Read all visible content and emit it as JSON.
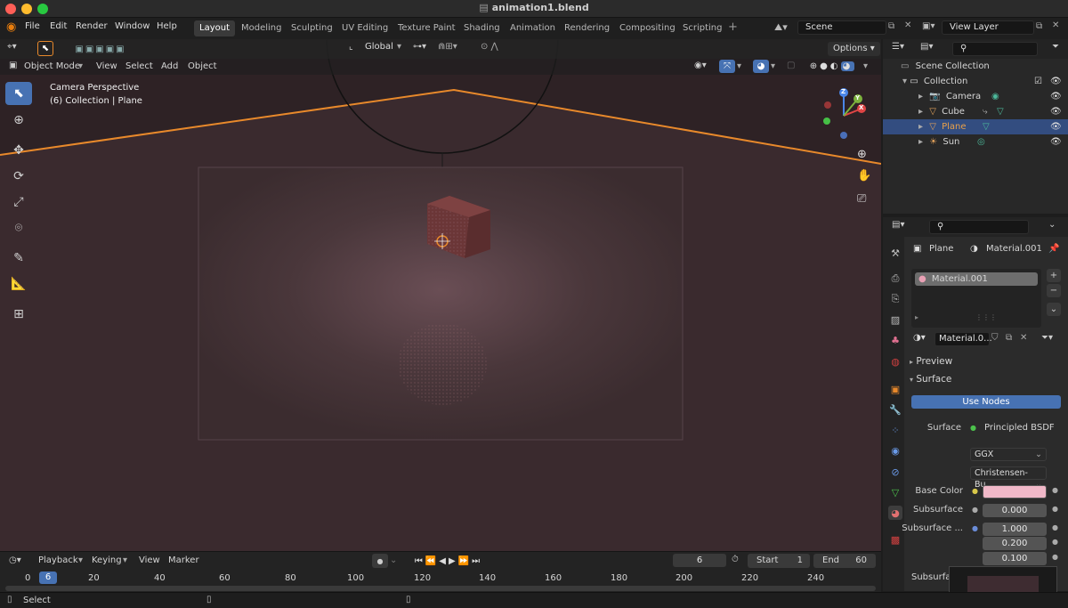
{
  "window": {
    "title": "animation1.blend"
  },
  "menu": {
    "file": "File",
    "edit": "Edit",
    "render": "Render",
    "window": "Window",
    "help": "Help"
  },
  "workspaces": [
    "Layout",
    "Modeling",
    "Sculpting",
    "UV Editing",
    "Texture Paint",
    "Shading",
    "Animation",
    "Rendering",
    "Compositing",
    "Scripting"
  ],
  "scene": {
    "name": "Scene",
    "view_layer": "View Layer"
  },
  "viewport": {
    "mode": "Object Mode",
    "menus": [
      "View",
      "Select",
      "Add",
      "Object"
    ],
    "transform_orientation": "Global",
    "options_label": "Options",
    "overlay_title": "Camera Perspective",
    "overlay_subtitle": "(6) Collection | Plane",
    "gizmo_axes": {
      "x": "X",
      "y": "Y",
      "z": "Z"
    }
  },
  "outliner": {
    "root": "Scene Collection",
    "collection": "Collection",
    "items": [
      {
        "name": "Camera",
        "icon": "camera-icon",
        "color": "#e0a05a"
      },
      {
        "name": "Cube",
        "icon": "mesh-icon",
        "color": "#e0a05a"
      },
      {
        "name": "Plane",
        "icon": "mesh-icon",
        "color": "#e0a05a",
        "selected": true
      },
      {
        "name": "Sun",
        "icon": "light-icon",
        "color": "#e0a05a"
      }
    ]
  },
  "properties": {
    "object_name": "Plane",
    "material_name": "Material.001",
    "slot_name": "Material.001",
    "material_field": "Material.0...",
    "panels": {
      "preview": "Preview",
      "surface": "Surface"
    },
    "use_nodes_label": "Use Nodes",
    "surface_label": "Surface",
    "surface_shader": "Principled BSDF",
    "distribution": "GGX",
    "subsurface_method": "Christensen-Bu...",
    "base_color_label": "Base Color",
    "base_color": "#f0b8c8",
    "subsurface_label": "Subsurface",
    "subsurface_value": "0.000",
    "subsurface_radius_label": "Subsurface ...",
    "subsurface_radius": [
      "1.000",
      "0.200",
      "0.100"
    ],
    "subsurface_color_label": "Subsurfa"
  },
  "timeline": {
    "menus": [
      "Playback",
      "Keying",
      "View",
      "Marker"
    ],
    "current_frame": "6",
    "start_label": "Start",
    "start_value": "1",
    "end_label": "End",
    "end_value": "60",
    "ruler": [
      "0",
      "20",
      "40",
      "60",
      "80",
      "100",
      "120",
      "140",
      "160",
      "180",
      "200",
      "220",
      "240"
    ],
    "ruler_frame": "6"
  },
  "status": {
    "select_label": "Select"
  },
  "colors": {
    "accent": "#4772b3",
    "selection_orange": "#e8892b",
    "active_row": "#334d80"
  }
}
